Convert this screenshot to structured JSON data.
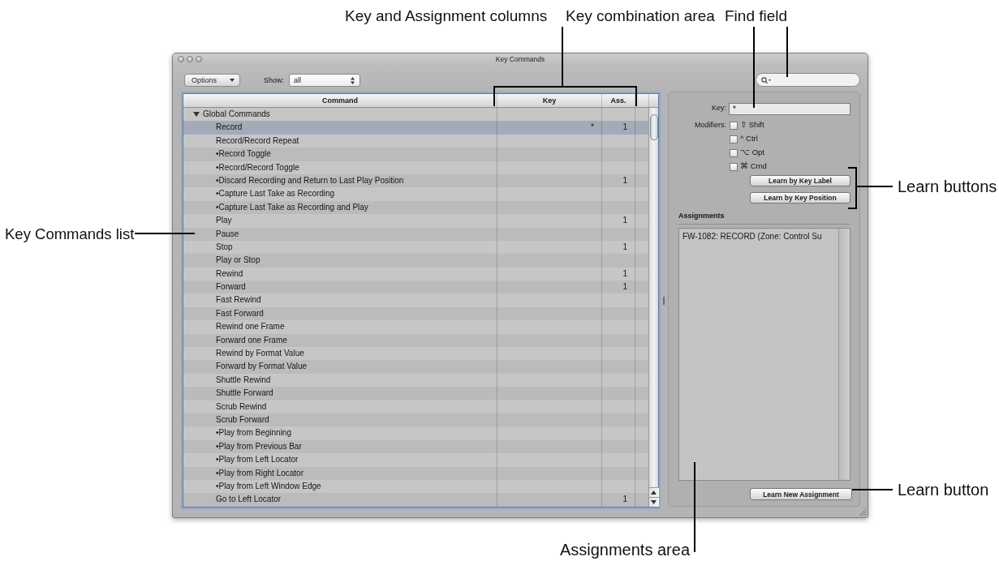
{
  "window": {
    "title": "Key Commands"
  },
  "toolbar": {
    "options_menu": "Options",
    "show_label": "Show:",
    "show_value": "all"
  },
  "command_table": {
    "columns": [
      "Command",
      "Key",
      "Ass."
    ],
    "groups": [
      {
        "label": "Global Commands",
        "expanded": true,
        "children": [
          {
            "command": "Record",
            "key": "*",
            "assignments": "1",
            "selected": true
          },
          {
            "command": "Record/Record Repeat",
            "selected": false
          },
          {
            "command": "•Record Toggle",
            "selected": false
          },
          {
            "command": "•Record/Record Toggle",
            "selected": false
          },
          {
            "command": "•Discard Recording and Return to Last Play Position",
            "assignments": "1",
            "selected": false
          },
          {
            "command": "•Capture Last Take as Recording",
            "selected": false
          },
          {
            "command": "•Capture Last Take as Recording and Play",
            "selected": false
          },
          {
            "command": "Play",
            "assignments": "1",
            "selected": false
          },
          {
            "command": "Pause",
            "selected": false
          },
          {
            "command": "Stop",
            "assignments": "1",
            "selected": false
          },
          {
            "command": "Play or Stop",
            "selected": false
          },
          {
            "command": "Rewind",
            "assignments": "1",
            "selected": false
          },
          {
            "command": "Forward",
            "assignments": "1",
            "selected": false
          },
          {
            "command": "Fast Rewind",
            "selected": false
          },
          {
            "command": "Fast Forward",
            "selected": false
          },
          {
            "command": "Rewind one Frame",
            "selected": false
          },
          {
            "command": "Forward one Frame",
            "selected": false
          },
          {
            "command": "Rewind by Format Value",
            "selected": false
          },
          {
            "command": "Forward by Format Value",
            "selected": false
          },
          {
            "command": "Shuttle Rewind",
            "selected": false
          },
          {
            "command": "Shuttle Forward",
            "selected": false
          },
          {
            "command": "Scrub Rewind",
            "selected": false
          },
          {
            "command": "Scrub Forward",
            "selected": false
          },
          {
            "command": "•Play from Beginning",
            "selected": false
          },
          {
            "command": "•Play from Previous Bar",
            "selected": false
          },
          {
            "command": "•Play from Left Locator",
            "selected": false
          },
          {
            "command": "•Play from Right Locator",
            "selected": false
          },
          {
            "command": "•Play from Left Window Edge",
            "selected": false
          },
          {
            "command": "Go to Left Locator",
            "assignments": "1",
            "selected": false
          }
        ]
      }
    ]
  },
  "key_panel": {
    "key_label": "Key:",
    "key_value": "*",
    "modifiers_label": "Modifiers:",
    "modifiers": [
      {
        "label": "⇧ Shift",
        "checked": false
      },
      {
        "label": "^ Ctrl",
        "checked": false
      },
      {
        "label": "⌥ Opt",
        "checked": false
      },
      {
        "label": "⌘ Cmd",
        "checked": false
      }
    ],
    "learn_buttons": [
      "Learn by Key Label",
      "Learn by Key Position"
    ]
  },
  "assignments": {
    "title": "Assignments",
    "items": [
      "FW-1082: RECORD (Zone: Control Su"
    ],
    "learn_button": "Learn New Assignment"
  },
  "callouts": [
    {
      "label": "Key and Assignment columns"
    },
    {
      "label": "Key combination area"
    },
    {
      "label": "Find field"
    },
    {
      "label": "Learn buttons"
    },
    {
      "label": "Key Commands list"
    },
    {
      "label": "Learn button"
    },
    {
      "label": "Assignments area"
    }
  ]
}
